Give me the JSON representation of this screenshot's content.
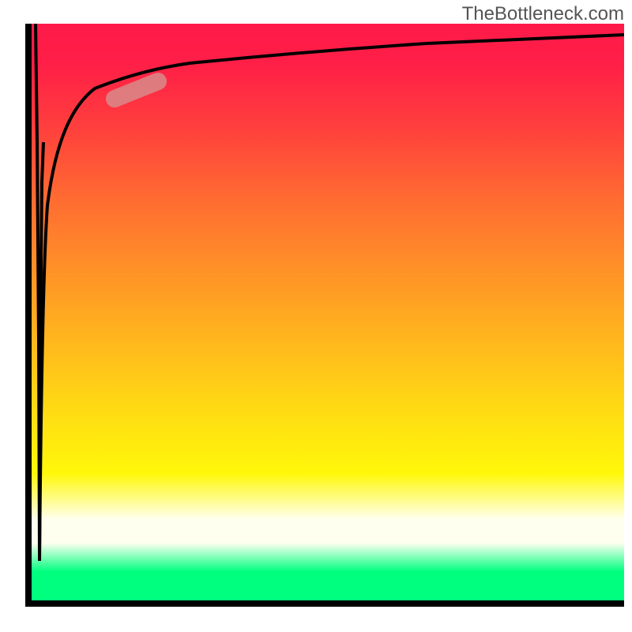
{
  "attribution": "TheBottleneck.com",
  "chart_data": {
    "type": "line",
    "title": "",
    "xlabel": "",
    "ylabel": "",
    "xlim": [
      0,
      100
    ],
    "ylim": [
      0,
      100
    ],
    "grid": false,
    "series": [
      {
        "name": "curve",
        "x": [
          1.0,
          1.2,
          1.5,
          2.0,
          2.5,
          3.0,
          4.0,
          5.0,
          7.0,
          10.0,
          15.0,
          22.0,
          30.0,
          45.0,
          65.0,
          100.0
        ],
        "y": [
          3.0,
          25.0,
          45.0,
          60.0,
          70.0,
          76.0,
          82.0,
          85.5,
          88.5,
          90.5,
          92.0,
          93.3,
          94.3,
          95.5,
          96.5,
          97.5
        ]
      }
    ],
    "marker": {
      "name": "highlight-segment",
      "x1": 14.0,
      "y1": 87.0,
      "x2": 21.0,
      "y2": 90.0,
      "color": "#d98a8a"
    },
    "background_gradient": [
      "#ff1a49",
      "#ff8f28",
      "#fff80a",
      "#fffff0",
      "#00ff7f"
    ]
  }
}
